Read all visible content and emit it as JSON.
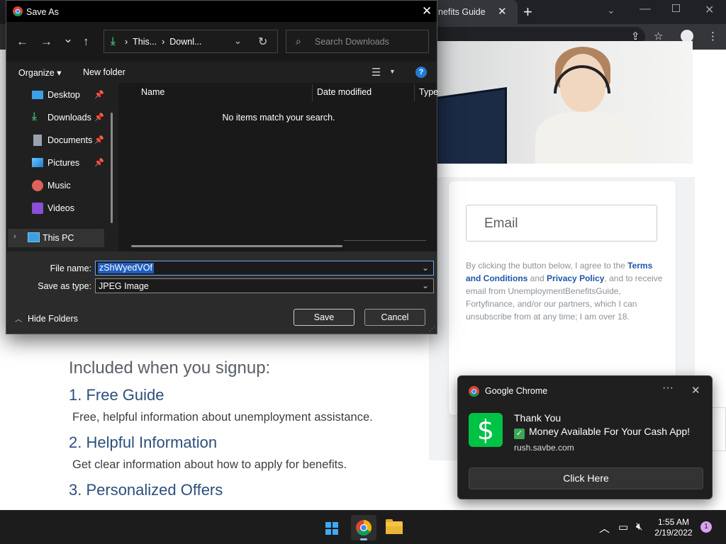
{
  "browser": {
    "tab_title": "nefits Guide",
    "tab_close": "✕",
    "new_tab": "+",
    "tab_search_icon": "chevron-down-icon",
    "page": {
      "email_placeholder": "Email",
      "consent_prefix": "By clicking the button below, I agree to the ",
      "consent_link1": "Terms and Conditions",
      "consent_mid": " and ",
      "consent_link2": "Privacy Policy",
      "consent_suffix": ", and to receive email from UnemploymentBenefitsGuide, Fortyfinance, and/or our partners, which I can unsubscribe from at any time; I am over 18.",
      "included_title": "Included when you signup:",
      "steps": [
        {
          "heading": "1. Free Guide",
          "text": "Free, helpful information about unemployment assistance."
        },
        {
          "heading": "2. Helpful Information",
          "text": "Get clear information about how to apply for benefits."
        },
        {
          "heading": "3. Personalized Offers",
          "text": ""
        }
      ]
    }
  },
  "dialog": {
    "title": "Save As",
    "close": "✕",
    "nav": {
      "back": "←",
      "forward": "→",
      "recent": "⌄",
      "up": "↑"
    },
    "address": {
      "segment1": "This...",
      "sep": "›",
      "segment2": "Downl..."
    },
    "search_placeholder": "Search Downloads",
    "toolbar": {
      "organize": "Organize ▾",
      "new_folder": "New folder"
    },
    "nav_items": [
      {
        "label": "Desktop",
        "pinned": true,
        "icon": "desktop-icon",
        "color": "#3ba0e6"
      },
      {
        "label": "Downloads",
        "pinned": true,
        "icon": "downloads-icon",
        "color": "#3fb070"
      },
      {
        "label": "Documents",
        "pinned": true,
        "icon": "documents-icon",
        "color": "#9aa3ad"
      },
      {
        "label": "Pictures",
        "pinned": true,
        "icon": "pictures-icon",
        "color": "#3ba0e6"
      },
      {
        "label": "Music",
        "pinned": false,
        "icon": "music-icon",
        "color": "#e0625b"
      },
      {
        "label": "Videos",
        "pinned": false,
        "icon": "videos-icon",
        "color": "#8a4fd6"
      }
    ],
    "this_pc": "This PC",
    "columns": [
      "Name",
      "Date modified",
      "Type"
    ],
    "empty_message": "No items match your search.",
    "file_name_label": "File name:",
    "file_name_value": "zShWyedVOf",
    "save_type_label": "Save as type:",
    "save_type_value": "JPEG Image",
    "hide_folders": "Hide Folders",
    "save_button": "Save",
    "cancel_button": "Cancel"
  },
  "toast": {
    "app_name": "Google Chrome",
    "more": "···",
    "close": "✕",
    "icon_symbol": "$",
    "title": "Thank You",
    "body": "Money Available For Your Cash App!",
    "check": "✓",
    "source": "rush.savbe.com",
    "action": "Click Here"
  },
  "taskbar": {
    "time": "1:55 AM",
    "date": "2/19/2022",
    "notification_count": "1",
    "tray_chevron": "︿"
  }
}
